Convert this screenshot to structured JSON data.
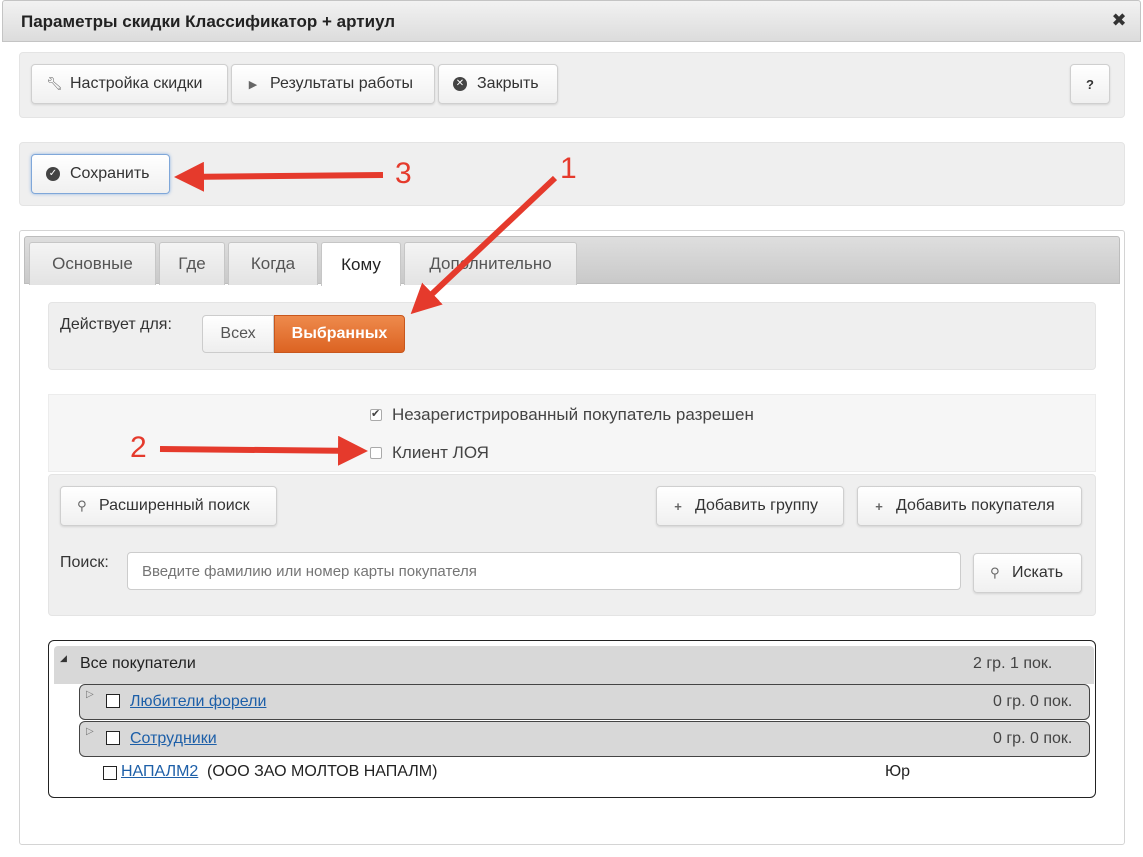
{
  "window": {
    "title": "Параметры скидки Классификатор + артиул",
    "close_symbol": "✖"
  },
  "toolbar": {
    "settings_label": "Настройка скидки",
    "results_label": "Результаты работы",
    "close_label": "Закрыть",
    "help_label": "?"
  },
  "save": {
    "label": "Сохранить"
  },
  "tabs": [
    {
      "label": "Основные"
    },
    {
      "label": "Где"
    },
    {
      "label": "Когда"
    },
    {
      "label": "Кому"
    },
    {
      "label": "Дополнительно"
    }
  ],
  "applies": {
    "label": "Действует для:",
    "option_all": "Всех",
    "option_selected": "Выбранных",
    "selected_color": "#e06b27"
  },
  "options": {
    "unregistered_label": "Незарегистрированный покупатель разрешен",
    "unregistered_checked": true,
    "loyalty_label": "Клиент ЛОЯ",
    "loyalty_checked": false
  },
  "search": {
    "advanced_label": "Расширенный поиск",
    "add_group_label": "Добавить группу",
    "add_customer_label": "Добавить покупателя",
    "label": "Поиск:",
    "placeholder": "Введите фамилию или номер карты покупателя",
    "button_label": "Искать"
  },
  "tree": {
    "root": {
      "label": "Все покупатели",
      "count": "2 гр. 1 пок."
    },
    "groups": [
      {
        "label": "Любители форели",
        "count": "0 гр. 0 пок."
      },
      {
        "label": "Сотрудники",
        "count": "0 гр. 0 пок."
      }
    ],
    "customer": {
      "name": "НАПАЛМ2",
      "org": "(ООО ЗАО МОЛТОВ НАПАЛМ)",
      "type": "Юр"
    }
  },
  "annotations": {
    "one": "1",
    "two": "2",
    "three": "3",
    "arrow_color": "#e53a2c"
  }
}
